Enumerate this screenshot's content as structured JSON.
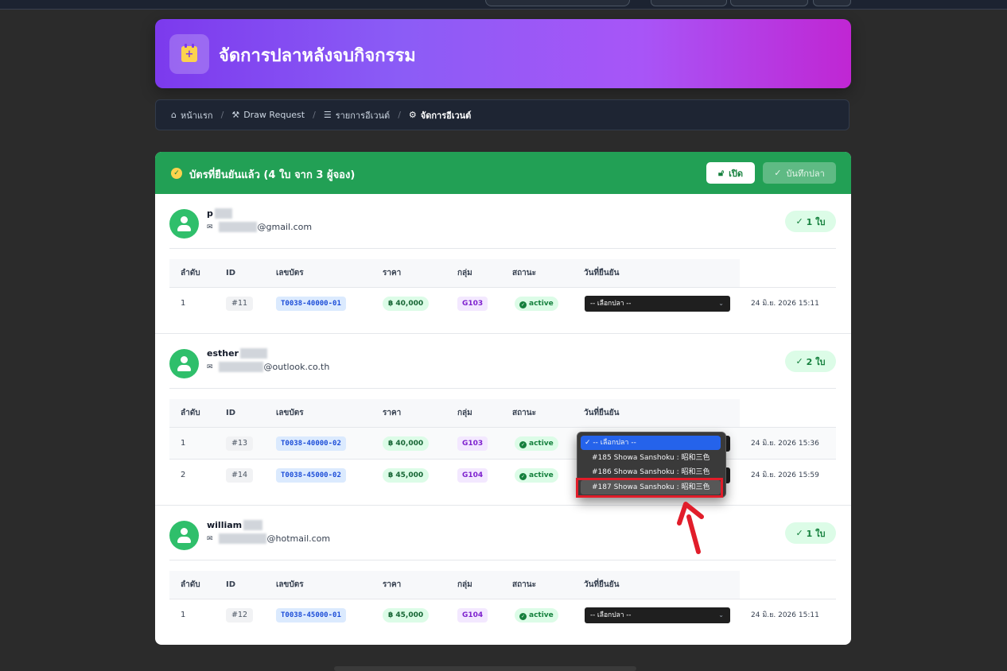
{
  "header": {
    "title": "จัดการปลาหลังจบกิจกรรม",
    "icon": "calendar-plus-icon"
  },
  "breadcrumb": [
    {
      "label": "หน้าแรก",
      "icon": "store-icon"
    },
    {
      "label": "Draw Request",
      "icon": "hammer-icon"
    },
    {
      "label": "รายการอีเวนต์",
      "icon": "list-icon"
    },
    {
      "label": "จัดการอีเวนต์",
      "icon": "gear-icon"
    }
  ],
  "panel": {
    "title": "บัตรที่ยืนยันแล้ว (4 ใบ จาก 3 ผู้จอง)",
    "open_button": "เปิด",
    "save_button": "บันทึกปลา",
    "accent": "#22a055"
  },
  "table_headers": [
    "ลำดับ",
    "ID",
    "เลขบัตร",
    "ราคา",
    "กลุ่ม",
    "สถานะ",
    "วันที่ยืนยัน"
  ],
  "select_placeholder": "-- เลือกปลา --",
  "users": [
    {
      "name": "p",
      "email": "@gmail.com",
      "count": "1 ใบ",
      "rows": [
        {
          "no": "1",
          "id": "#11",
          "ticket": "T0038-40000-01",
          "price": "฿ 40,000",
          "group": "G103",
          "status": "active",
          "date": "24 มิ.ย. 2026 15:11"
        }
      ]
    },
    {
      "name": "esther",
      "email": "@outlook.co.th",
      "count": "2 ใบ",
      "rows": [
        {
          "no": "1",
          "id": "#13",
          "ticket": "T0038-40000-02",
          "price": "฿ 40,000",
          "group": "G103",
          "status": "active",
          "date": "24 มิ.ย. 2026 15:36"
        },
        {
          "no": "2",
          "id": "#14",
          "ticket": "T0038-45000-02",
          "price": "฿ 45,000",
          "group": "G104",
          "status": "active",
          "date": "24 มิ.ย. 2026 15:59"
        }
      ]
    },
    {
      "name": "william",
      "email": "@hotmail.com",
      "count": "1 ใบ",
      "rows": [
        {
          "no": "1",
          "id": "#12",
          "ticket": "T0038-45000-01",
          "price": "฿ 45,000",
          "group": "G104",
          "status": "active",
          "date": "24 มิ.ย. 2026 15:11"
        }
      ]
    }
  ],
  "dropdown_options": [
    "-- เลือกปลา --",
    "#185 Showa Sanshoku : 昭和三色",
    "#186 Showa Sanshoku : 昭和三色",
    "#187 Showa Sanshoku : 昭和三色"
  ]
}
